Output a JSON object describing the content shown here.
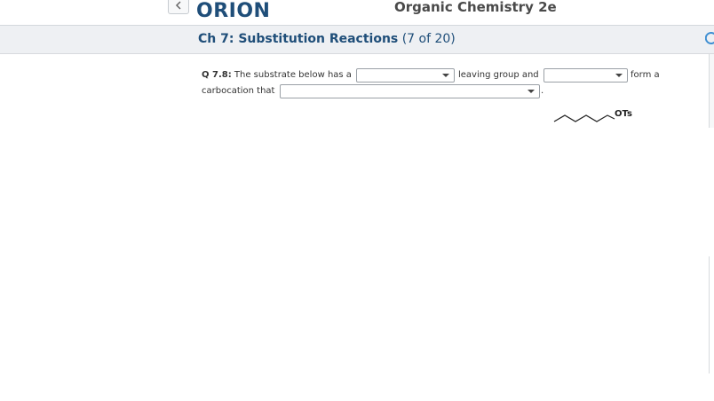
{
  "header": {
    "logo": "ORION",
    "book_title": "Organic Chemistry 2e",
    "back_icon": "chevron-left-icon"
  },
  "chapter": {
    "title": "Ch 7: Substitution Reactions",
    "progress": "(7 of 20)",
    "refresh_icon": "refresh-icon"
  },
  "question": {
    "label": "Q 7.8:",
    "text_1": "The substrate below has a",
    "text_2": "leaving group and",
    "text_3": "form a",
    "text_4": "carbocation that",
    "text_5": ".",
    "dropdown_1_value": "",
    "dropdown_2_value": "",
    "dropdown_3_value": "",
    "structure_label": "OTs"
  },
  "colors": {
    "brand": "#1f4e79",
    "chapter_bar": "#eef0f3"
  }
}
